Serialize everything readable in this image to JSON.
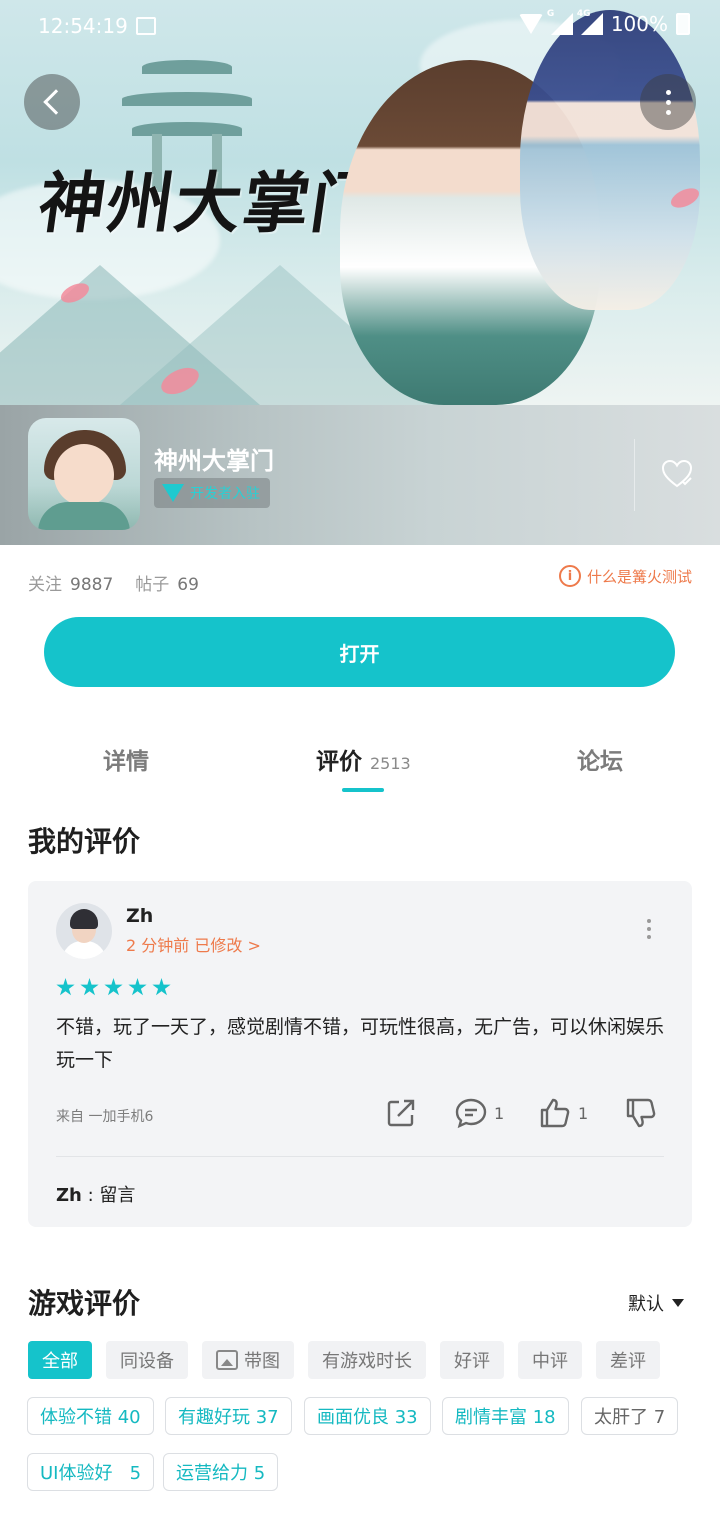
{
  "status_bar": {
    "time": "12:54:19",
    "network_1": "G",
    "network_2": "4G",
    "battery": "100%"
  },
  "banner": {
    "logo_text": "神州大掌门"
  },
  "game": {
    "name": "神州大掌门",
    "badge": "开发者入驻"
  },
  "stats": {
    "follow_label": "关注",
    "follow_value": "9887",
    "posts_label": "帖子",
    "posts_value": "69",
    "test_link": "什么是篝火测试",
    "info_icon_glyph": "i"
  },
  "open_button": "打开",
  "tabs": {
    "detail": "详情",
    "review": "评价",
    "review_count": "2513",
    "forum": "论坛"
  },
  "my_review": {
    "title": "我的评价",
    "user": "Zh",
    "time": "2 分钟前 已修改 >",
    "rating": 5,
    "text": "不错，玩了一天了，感觉剧情不错，可玩性很高，无广告，可以休闲娱乐玩一下",
    "device": "来自 一加手机6",
    "comment_count": "1",
    "like_count": "1",
    "reply_user": "Zh",
    "reply_sep": " : ",
    "reply_text": "留言"
  },
  "game_reviews": {
    "title": "游戏评价",
    "sort": "默认",
    "filters": [
      "全部",
      "同设备",
      "带图",
      "有游戏时长",
      "好评",
      "中评",
      "差评"
    ],
    "tags": [
      "体验不错 40",
      "有趣好玩 37",
      "画面优良 33",
      "剧情丰富 18",
      "太肝了 7",
      "UI体验好   5",
      "运营给力 5"
    ]
  },
  "colors": {
    "accent": "#15c3cb",
    "orange": "#ee7a4b"
  }
}
